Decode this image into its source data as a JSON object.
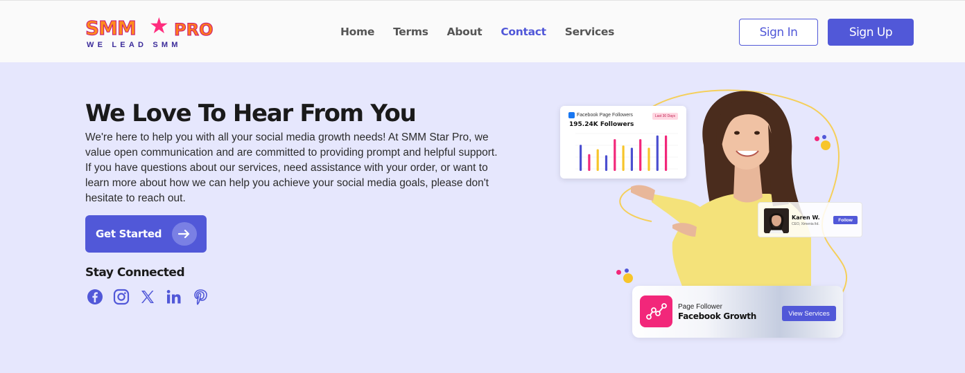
{
  "header": {
    "logo": {
      "main": "SMM",
      "pro": "PRO",
      "tagline": "WE LEAD SMM"
    },
    "nav": [
      {
        "label": "Home",
        "active": false
      },
      {
        "label": "Terms",
        "active": false
      },
      {
        "label": "About",
        "active": false
      },
      {
        "label": "Contact",
        "active": true
      },
      {
        "label": "Services",
        "active": false
      }
    ],
    "signin_label": "Sign In",
    "signup_label": "Sign Up"
  },
  "hero": {
    "title": "We Love To Hear From You",
    "description": "We're here to help you with all your social media growth needs! At SMM Star Pro, we value open communication and are committed to providing prompt and helpful support. If you have questions about our services, need assistance with your order, or want to learn more about how we can help you achieve your social media goals, please don't hesitate to reach out.",
    "cta_label": "Get Started",
    "stay_connected": "Stay Connected",
    "socials": [
      "facebook-icon",
      "instagram-icon",
      "x-icon",
      "linkedin-icon",
      "pinterest-icon"
    ]
  },
  "cards": {
    "chart": {
      "title": "Facebook Page Followers",
      "badge": "Last 30 Days",
      "followers": "195.24K Followers",
      "bars": [
        0.7,
        0.45,
        0.58,
        0.42,
        0.85,
        0.68,
        0.62,
        0.85,
        0.62,
        0.95,
        0.95
      ]
    },
    "karen": {
      "name": "Karen W.",
      "role": "CEO, Ximenia ltd.",
      "follow": "Follow"
    },
    "growth": {
      "subtitle": "Page Follower",
      "title": "Facebook Growth",
      "button": "View Services"
    }
  },
  "colors": {
    "accent": "#5158d8",
    "background": "#e6e7fd",
    "pink": "#f2277a",
    "yellow": "#f7c52a"
  }
}
